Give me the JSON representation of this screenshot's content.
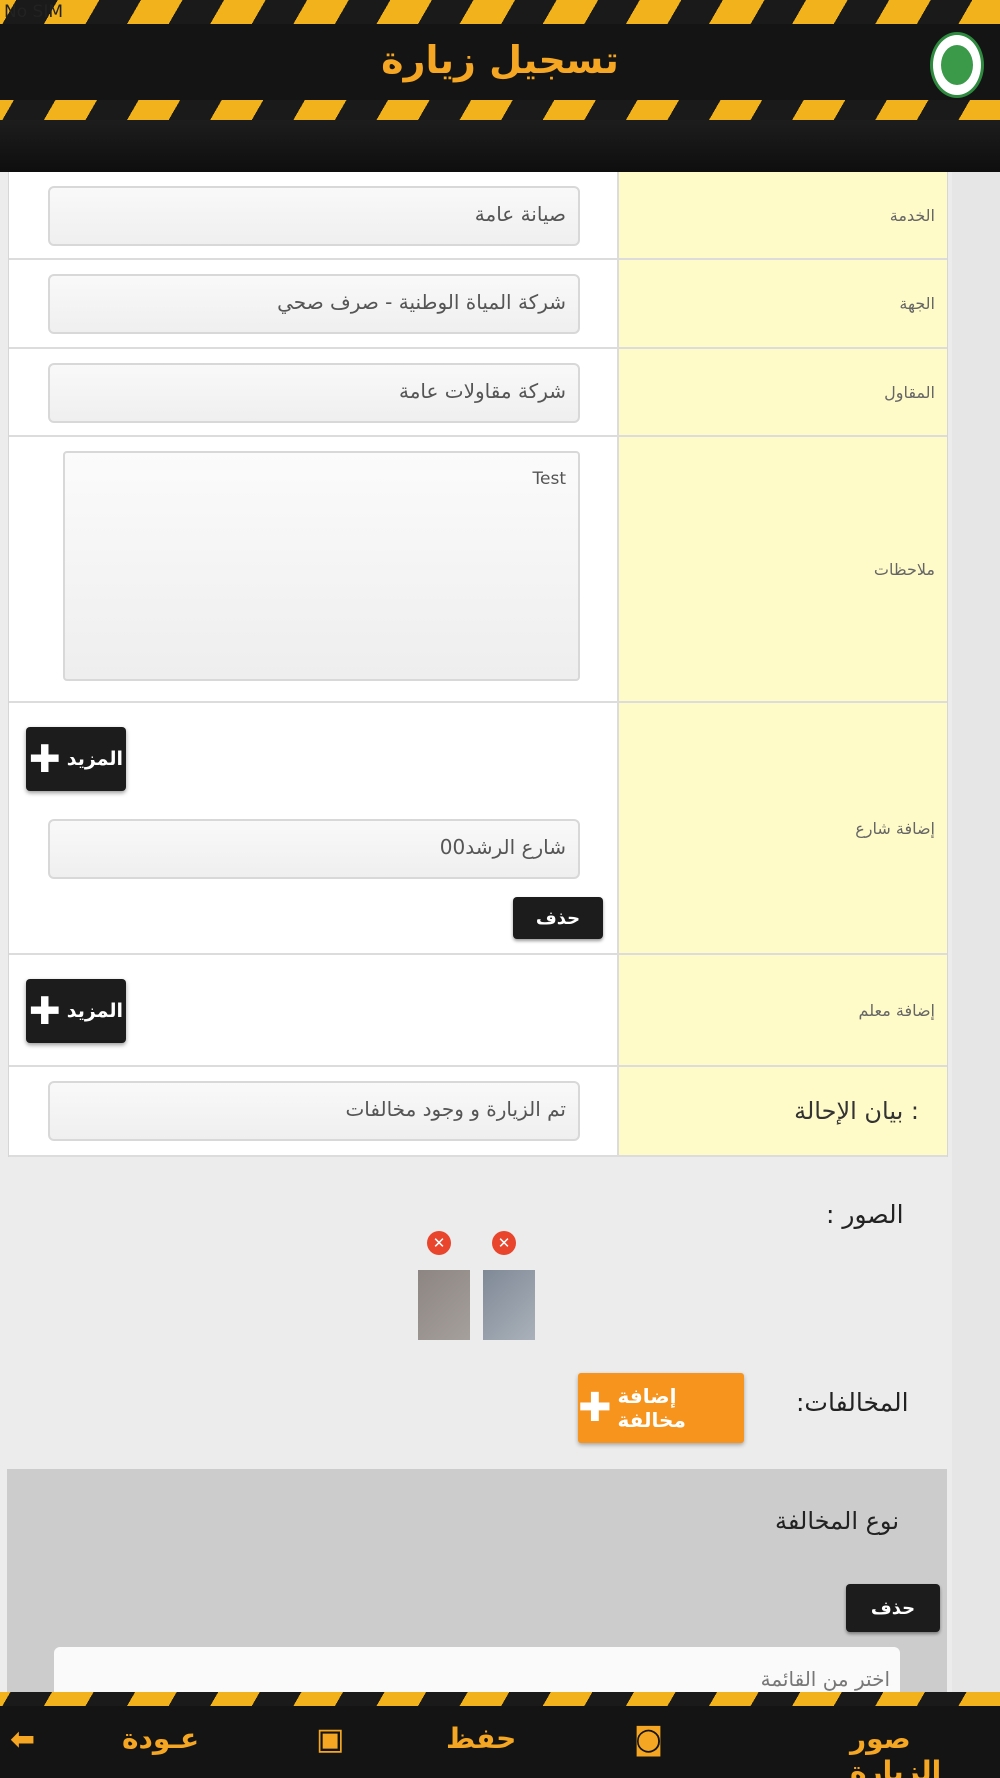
{
  "status_bar": {
    "carrier": "No SIM"
  },
  "header": {
    "title": "تسجيل زيارة",
    "logo_icon": "municipality-logo"
  },
  "form": {
    "service": {
      "label": "الخدمة",
      "value": "صيانة عامة"
    },
    "entity": {
      "label": "الجهة",
      "value": "شركة المياة الوطنية - صرف صحي"
    },
    "contractor": {
      "label": "المقاول",
      "value": "شركة مقاولات عامة"
    },
    "notes": {
      "label": "ملاحظات",
      "value": "Test"
    },
    "add_street": {
      "label": "إضافة شارع",
      "more_label": "المزيد",
      "street_value": "شارع الرشد00",
      "delete_label": "حذف"
    },
    "add_landmark": {
      "label": "إضافة معلم",
      "more_label": "المزيد"
    },
    "referral": {
      "label": "بيان الإحالة :",
      "value": "تم الزيارة و وجود مخالفات"
    }
  },
  "photos": {
    "label": "الصور :",
    "count": 2
  },
  "violations": {
    "label": "المخالفات:",
    "add_label": "إضافة مخالفة",
    "type_label": "نوع المخالفة",
    "delete_label": "حذف",
    "select_placeholder": "اختر من القائمة"
  },
  "footer": {
    "back_label": "عـودة",
    "save_label": "حفظ",
    "photos_label": "صور الزيارة"
  },
  "colors": {
    "accent": "#f5a623",
    "label_bg": "#fffbc8",
    "dark": "#141414",
    "orange_button": "#f7941d"
  }
}
